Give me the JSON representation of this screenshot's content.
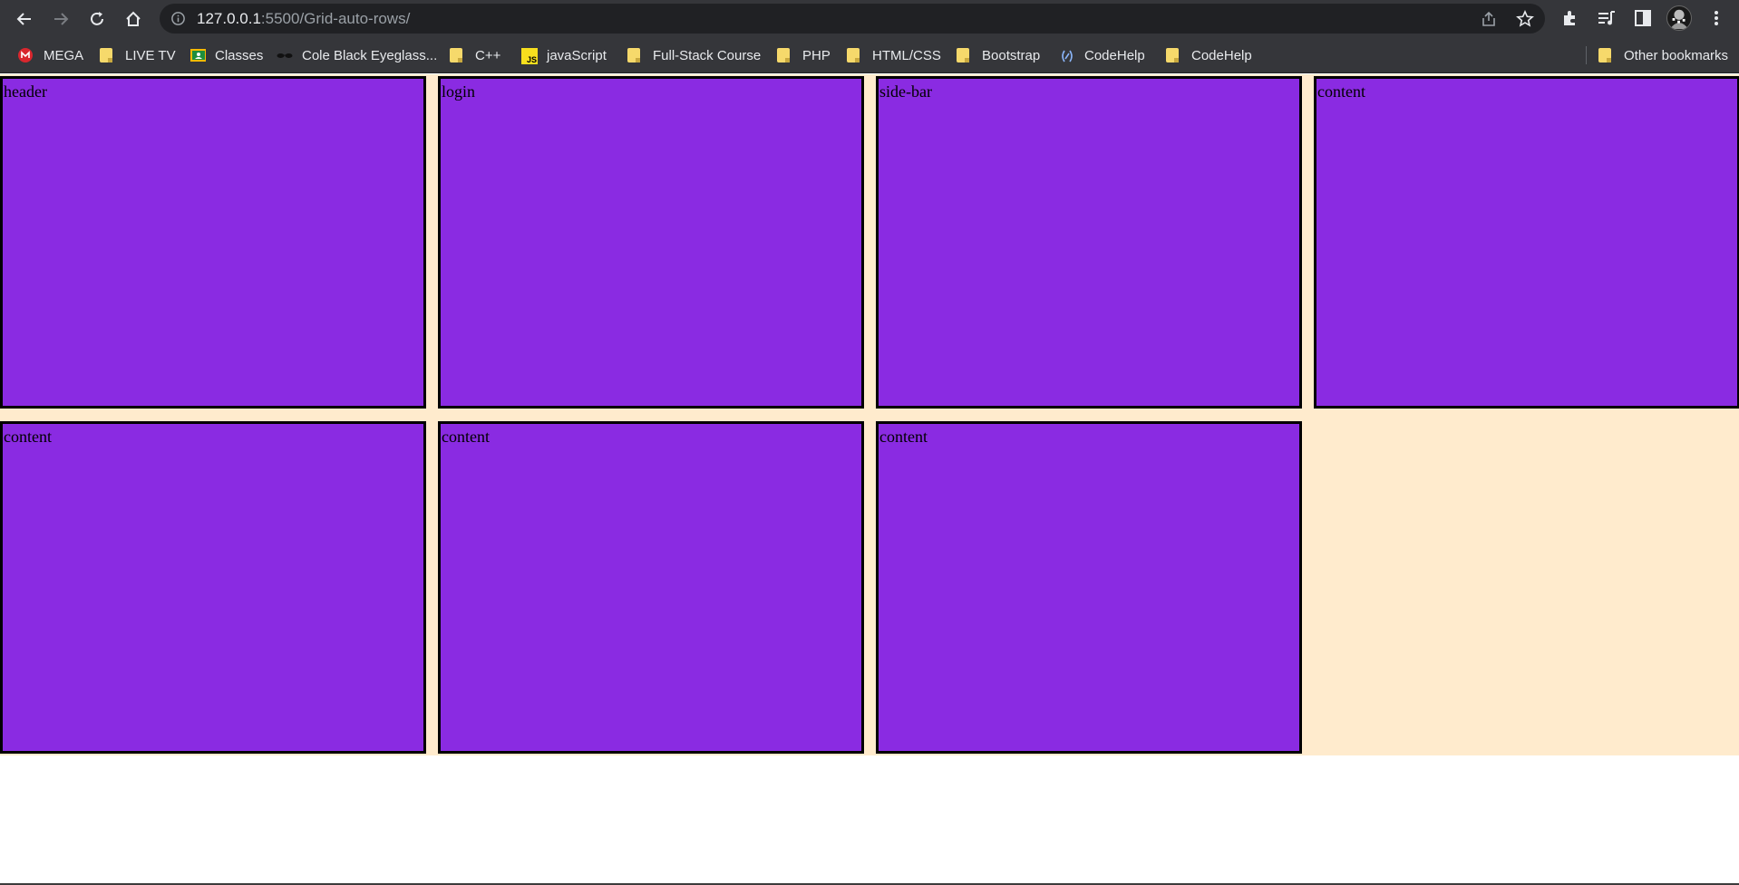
{
  "browser": {
    "url_host": "127.0.0.1",
    "url_path": ":5500/Grid-auto-rows/",
    "bookmarks": [
      {
        "label": "MEGA",
        "icon": "mega-icon"
      },
      {
        "label": "LIVE TV",
        "icon": "folder-icon"
      },
      {
        "label": "Classes",
        "icon": "classroom-icon"
      },
      {
        "label": "Cole Black Eyeglass...",
        "icon": "eyeglasses-icon"
      },
      {
        "label": "C++",
        "icon": "folder-icon"
      },
      {
        "label": "javaScript",
        "icon": "js-icon"
      },
      {
        "label": "Full-Stack Course",
        "icon": "folder-icon"
      },
      {
        "label": "PHP",
        "icon": "folder-icon"
      },
      {
        "label": "HTML/CSS",
        "icon": "folder-icon"
      },
      {
        "label": "Bootstrap",
        "icon": "folder-icon"
      },
      {
        "label": "CodeHelp",
        "icon": "codehelp-icon"
      },
      {
        "label": "CodeHelp",
        "icon": "folder-icon"
      }
    ],
    "other_bookmarks": "Other bookmarks"
  },
  "grid": {
    "items": [
      {
        "label": "header"
      },
      {
        "label": "login"
      },
      {
        "label": "side-bar"
      },
      {
        "label": "content"
      },
      {
        "label": "content"
      },
      {
        "label": "content"
      },
      {
        "label": "content"
      }
    ]
  },
  "colors": {
    "item_background": "#8a2be2",
    "grid_background": "#ffebcd",
    "chrome_background": "#35363a"
  }
}
